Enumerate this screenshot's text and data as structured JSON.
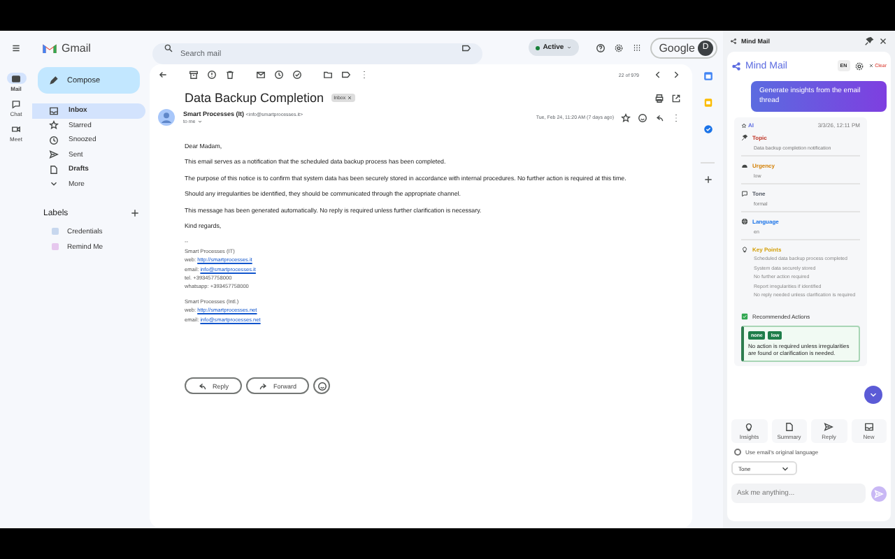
{
  "rail": [
    {
      "label": "Mail",
      "selected": true
    },
    {
      "label": "Chat",
      "selected": false
    },
    {
      "label": "Meet",
      "selected": false
    }
  ],
  "brand": "Gmail",
  "compose": "Compose",
  "nav": [
    {
      "label": "Inbox",
      "selected": true,
      "unread": true
    },
    {
      "label": "Starred",
      "selected": false,
      "unread": false
    },
    {
      "label": "Snoozed",
      "selected": false,
      "unread": false
    },
    {
      "label": "Sent",
      "selected": false,
      "unread": false
    },
    {
      "label": "Drafts",
      "selected": false,
      "unread": true
    },
    {
      "label": "More",
      "selected": false,
      "unread": false
    }
  ],
  "labels": {
    "title": "Labels",
    "items": [
      {
        "label": "Credentials",
        "color": "#c7d7ee"
      },
      {
        "label": "Remind Me",
        "color": "#e6c8ee"
      }
    ]
  },
  "search": {
    "placeholder": "Search mail"
  },
  "status": "Active",
  "account": {
    "label": "Google",
    "initial": "D"
  },
  "pager": "22 of 979",
  "email": {
    "subject": "Data Backup Completion",
    "badge": "Inbox",
    "sender": "Smart Processes (It)",
    "address": "<info@smartprocesses.it>",
    "to": "to me",
    "date": "Tue, Feb 24, 11:20 AM (7 days ago)",
    "body": [
      "Dear Madam,",
      "This email serves as a notification that the scheduled data backup process has been completed.",
      "The purpose of this notice is to confirm that system data has been securely stored in accordance with internal procedures. No further action is required at this time.",
      "Should any irregularities be identified, they should be communicated through the appropriate channel.",
      "This message has been generated automatically. No reply is required unless further clarification is necessary.",
      "Kind regards,"
    ],
    "signature": [
      {
        "lines": [
          {
            "kind": "text",
            "text": "--"
          },
          {
            "kind": "text",
            "text": "Smart Processes (IT)"
          },
          {
            "kind": "link",
            "prefix": "web:",
            "text": "http://smartprocesses.it"
          },
          {
            "kind": "link",
            "prefix": "email:",
            "text": "info@smartprocesses.it"
          },
          {
            "kind": "text",
            "text": "tel. +393457758000"
          },
          {
            "kind": "text",
            "text": "whatsapp: +393457758000"
          }
        ]
      },
      {
        "lines": [
          {
            "kind": "text",
            "text": "Smart Processes (Intl.)"
          },
          {
            "kind": "link",
            "prefix": "web:",
            "text": "http://smartprocesses.net"
          },
          {
            "kind": "link",
            "prefix": "email:",
            "text": "info@smartprocesses.net"
          }
        ]
      }
    ],
    "actions": [
      "Reply",
      "Forward"
    ]
  },
  "panel": {
    "title": "Mind Mail",
    "brand": "Mind Mail",
    "language": "EN",
    "clear": "Clear",
    "prompt": "Generate insights from the email thread",
    "author": "AI",
    "time": "3/3/26, 12:11 PM",
    "sections": [
      {
        "title": "Topic",
        "color": "#c0392b",
        "value": "Data backup completion notification"
      },
      {
        "title": "Urgency",
        "color": "#d4830b",
        "value": "low"
      },
      {
        "title": "Tone",
        "color": "#555b66",
        "value": "formal"
      },
      {
        "title": "Language",
        "color": "#1a73e8",
        "value": "en"
      }
    ],
    "key_points": {
      "title": "Key Points",
      "color": "#d4a00b",
      "items": [
        "Scheduled data backup process completed",
        "System data securely stored",
        "No further action required",
        "Report irregularities if identified",
        "No reply needed unless clarification is required"
      ]
    },
    "recommended": {
      "title": "Recommended Actions",
      "tags": [
        "none",
        "low"
      ],
      "text": "No action is required unless irregularities are found or clarification is needed."
    },
    "tools": [
      "Insights",
      "Summary",
      "Reply",
      "New"
    ],
    "original_language": {
      "label": "Use email's original language",
      "checked": false
    },
    "tone": "Tone",
    "ask": {
      "placeholder": "Ask me anything..."
    }
  }
}
